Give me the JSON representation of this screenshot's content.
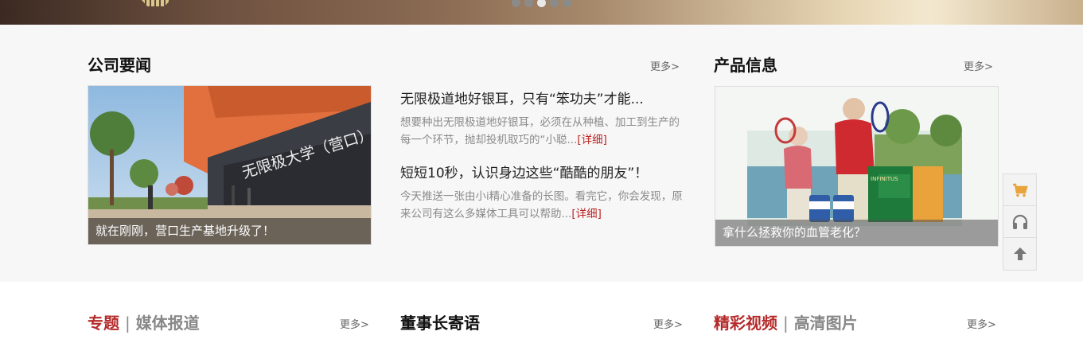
{
  "banner": {
    "dots": 5,
    "active_dot": 3
  },
  "company_news": {
    "title": "公司要闻",
    "more": "更多>",
    "photo_caption": "就在刚刚，营口生产基地升级了！",
    "photo_sign": "无限极大学（营口）校区",
    "items": [
      {
        "title": "无限极道地好银耳，只有“笨功夫”才能...",
        "desc": "想要种出无限极道地好银耳，必须在从种植、加工到生产的每一个环节，抛却投机取巧的“小聪...",
        "link": "[详细]"
      },
      {
        "title": "短短10秒，认识身边这些“酷酷的朋友”！",
        "desc": "今天推送一张由小i精心准备的长图。看完它，你会发现，原来公司有这么多媒体工具可以帮助...",
        "link": "[详细]"
      }
    ]
  },
  "product_info": {
    "title": "产品信息",
    "more": "更多>",
    "photo_caption": "拿什么拯救你的血管老化？",
    "box_label": "INFINITUS"
  },
  "float_bar": {
    "icons": [
      "cart-icon",
      "headphones-icon",
      "arrow-up-icon"
    ]
  },
  "bottom": {
    "col1": {
      "active": "专题",
      "sep": "|",
      "inactive": "媒体报道",
      "more": "更多>"
    },
    "col2": {
      "title": "董事长寄语",
      "more": "更多>"
    },
    "col3": {
      "active": "精彩视频",
      "sep": "|",
      "inactive": "高清图片",
      "more": "更多>"
    }
  },
  "colors": {
    "accent_red": "#b52a2a",
    "orange_icon": "#e8a33a",
    "caption_bg": "#1e1e1e"
  }
}
